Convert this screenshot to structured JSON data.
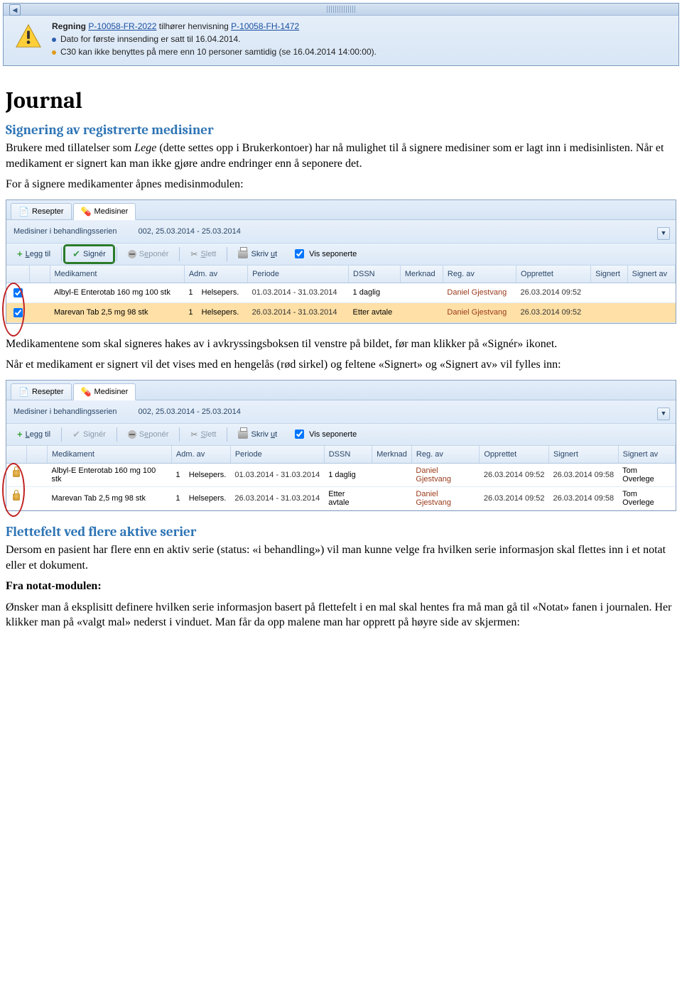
{
  "notif": {
    "label_regning": "Regning",
    "link_regning": "P-10058-FR-2022",
    "mid": "tilhører henvisning",
    "link_henv": "P-10058-FH-1472",
    "bullet1": "Dato for første innsending er satt til 16.04.2014.",
    "bullet2": "C30 kan ikke benyttes på mere enn 10 personer samtidig (se 16.04.2014 14:00:00)."
  },
  "h1": "Journal",
  "sect1_title": "Signering av registrerte medisiner",
  "sect1_p1a": "Brukere med tillatelser som ",
  "sect1_p1_em": "Lege",
  "sect1_p1b": " (dette settes opp i Brukerkontoer) har nå mulighet til å signere medisiner som er lagt inn i medisinlisten. Når et medikament er signert kan man ikke gjøre andre endringer enn å seponere det.",
  "sect1_p2": "For å signere medikamenter åpnes medisinmodulen:",
  "sect1_p3": "Medikamentene som skal signeres hakes av i avkryssingsboksen til venstre på bildet, før man klikker på «Signér» ikonet.",
  "sect1_p4": "Når et medikament er signert vil det vises med en hengelås (rød sirkel) og feltene «Signert» og «Signert av» vil fylles inn:",
  "sect2_title": "Flettefelt ved flere aktive serier",
  "sect2_p1": "Dersom en pasient har flere enn en aktiv serie (status: «i behandling») vil man kunne velge fra hvilken serie informasjon skal flettes inn i et notat eller et dokument.",
  "sect2_p2_label": "Fra notat-modulen:",
  "sect2_p3": "Ønsker man å eksplisitt definere hvilken serie informasjon basert på flettefelt i en mal skal hentes fra må man gå til «Notat» fanen i journalen. Her klikker man på «valgt mal» nederst i vinduet. Man får da opp malene man har opprett på høyre side av skjermen:",
  "ehr": {
    "tab_resepter": "Resepter",
    "tab_medisiner": "Medisiner",
    "info_label": "Medisiner i behandlingsserien",
    "info_value": "002,   25.03.2014 - 25.03.2014",
    "btn_legg": "Legg til",
    "btn_signer": "Signér",
    "btn_seponer": "Seponér",
    "btn_slett": "Slett",
    "btn_skriv": "Skriv ut",
    "chk_vis": "Vis seponerte",
    "cols": {
      "med": "Medikament",
      "adm": "Adm. av",
      "periode": "Periode",
      "dssn": "DSSN",
      "merknad": "Merknad",
      "reg": "Reg. av",
      "opprettet": "Opprettet",
      "signert": "Signert",
      "signert_av": "Signert av"
    },
    "rows1": [
      {
        "med": "Albyl-E Enterotab 160 mg 100 stk",
        "adm": "1",
        "adm2": "Helsepers.",
        "periode": "01.03.2014 - 31.03.2014",
        "dssn": "1 daglig",
        "merknad": "",
        "reg": "Daniel Gjestvang",
        "opprettet": "26.03.2014 09:52",
        "signert": "",
        "signert_av": ""
      },
      {
        "med": "Marevan Tab 2,5 mg 98 stk",
        "adm": "1",
        "adm2": "Helsepers.",
        "periode": "26.03.2014 - 31.03.2014",
        "dssn": "Etter avtale",
        "merknad": "",
        "reg": "Daniel Gjestvang",
        "opprettet": "26.03.2014 09:52",
        "signert": "",
        "signert_av": ""
      }
    ],
    "rows2": [
      {
        "med": "Albyl-E Enterotab 160 mg 100 stk",
        "adm": "1",
        "adm2": "Helsepers.",
        "periode": "01.03.2014 - 31.03.2014",
        "dssn": "1 daglig",
        "merknad": "",
        "reg": "Daniel Gjestvang",
        "opprettet": "26.03.2014 09:52",
        "signert": "26.03.2014 09:58",
        "signert_av": "Tom Overlege"
      },
      {
        "med": "Marevan Tab 2,5 mg 98 stk",
        "adm": "1",
        "adm2": "Helsepers.",
        "periode": "26.03.2014 - 31.03.2014",
        "dssn": "Etter avtale",
        "merknad": "",
        "reg": "Daniel Gjestvang",
        "opprettet": "26.03.2014 09:52",
        "signert": "26.03.2014 09:58",
        "signert_av": "Tom Overlege"
      }
    ]
  }
}
